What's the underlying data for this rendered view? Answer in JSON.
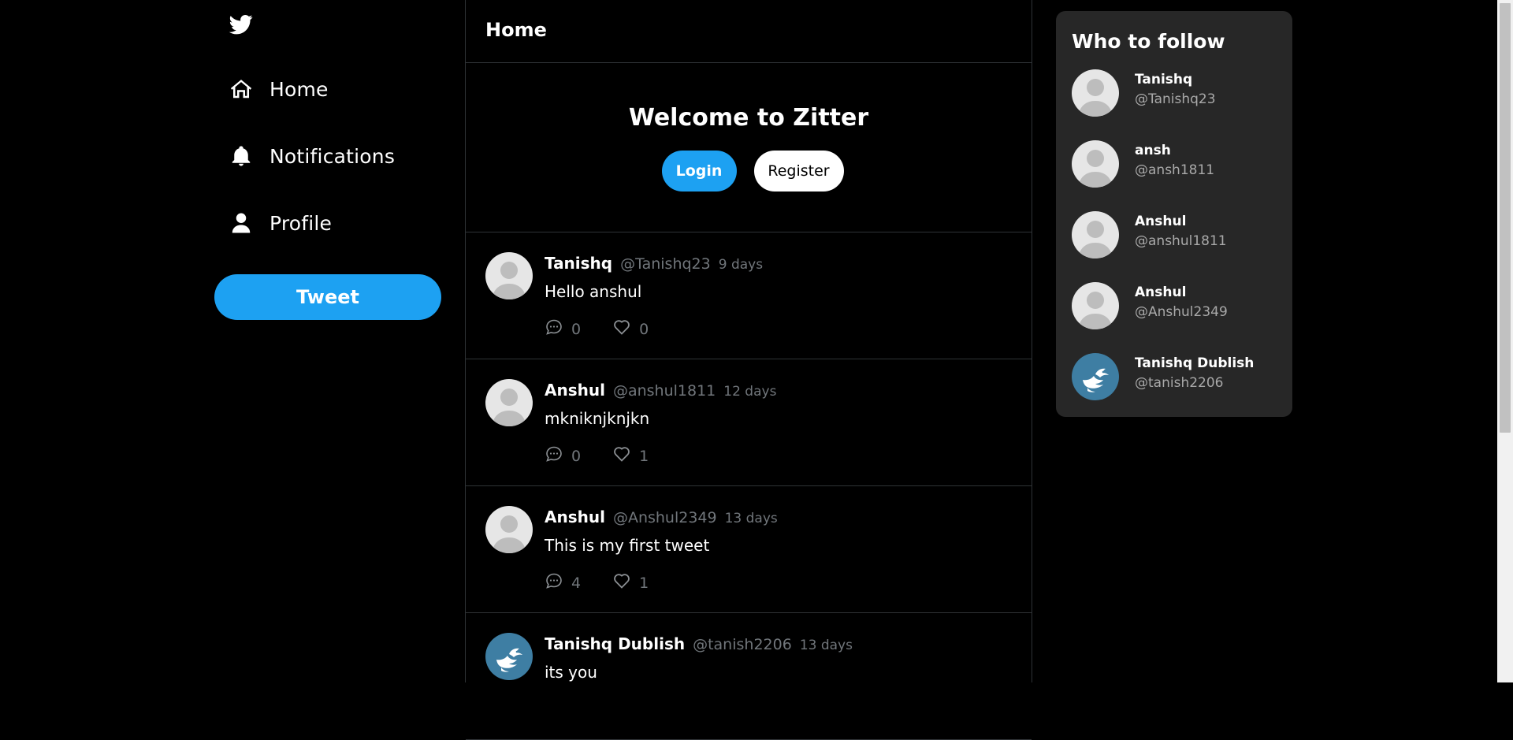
{
  "app": {
    "brand_icon": "twitter-bird-icon",
    "accent_color": "#1da1f2"
  },
  "sidebar": {
    "items": [
      {
        "label": "Home",
        "icon": "home-icon"
      },
      {
        "label": "Notifications",
        "icon": "bell-icon"
      },
      {
        "label": "Profile",
        "icon": "user-icon"
      }
    ],
    "tweet_label": "Tweet"
  },
  "header": {
    "title": "Home"
  },
  "welcome": {
    "heading": "Welcome to Zitter",
    "login_label": "Login",
    "register_label": "Register"
  },
  "tweets": [
    {
      "name": "Tanishq",
      "handle": "@Tanishq23",
      "time": "9 days",
      "text": "Hello anshul",
      "comments": "0",
      "likes": "0",
      "avatar": "default-avatar"
    },
    {
      "name": "Anshul",
      "handle": "@anshul1811",
      "time": "12 days",
      "text": "mkniknjknjkn",
      "comments": "0",
      "likes": "1",
      "avatar": "default-avatar"
    },
    {
      "name": "Anshul",
      "handle": "@Anshul2349",
      "time": "13 days",
      "text": "This is my first tweet",
      "comments": "4",
      "likes": "1",
      "avatar": "default-avatar"
    },
    {
      "name": "Tanishq Dublish",
      "handle": "@tanish2206",
      "time": "13 days",
      "text": "its you",
      "comments": "",
      "likes": "",
      "avatar": "bird-avatar"
    }
  ],
  "who_to_follow": {
    "title": "Who to follow",
    "users": [
      {
        "name": "Tanishq",
        "handle": "@Tanishq23",
        "avatar": "default-avatar"
      },
      {
        "name": "ansh",
        "handle": "@ansh1811",
        "avatar": "default-avatar"
      },
      {
        "name": "Anshul",
        "handle": "@anshul1811",
        "avatar": "default-avatar"
      },
      {
        "name": "Anshul",
        "handle": "@Anshul2349",
        "avatar": "default-avatar"
      },
      {
        "name": "Tanishq Dublish",
        "handle": "@tanish2206",
        "avatar": "bird-avatar"
      }
    ]
  }
}
